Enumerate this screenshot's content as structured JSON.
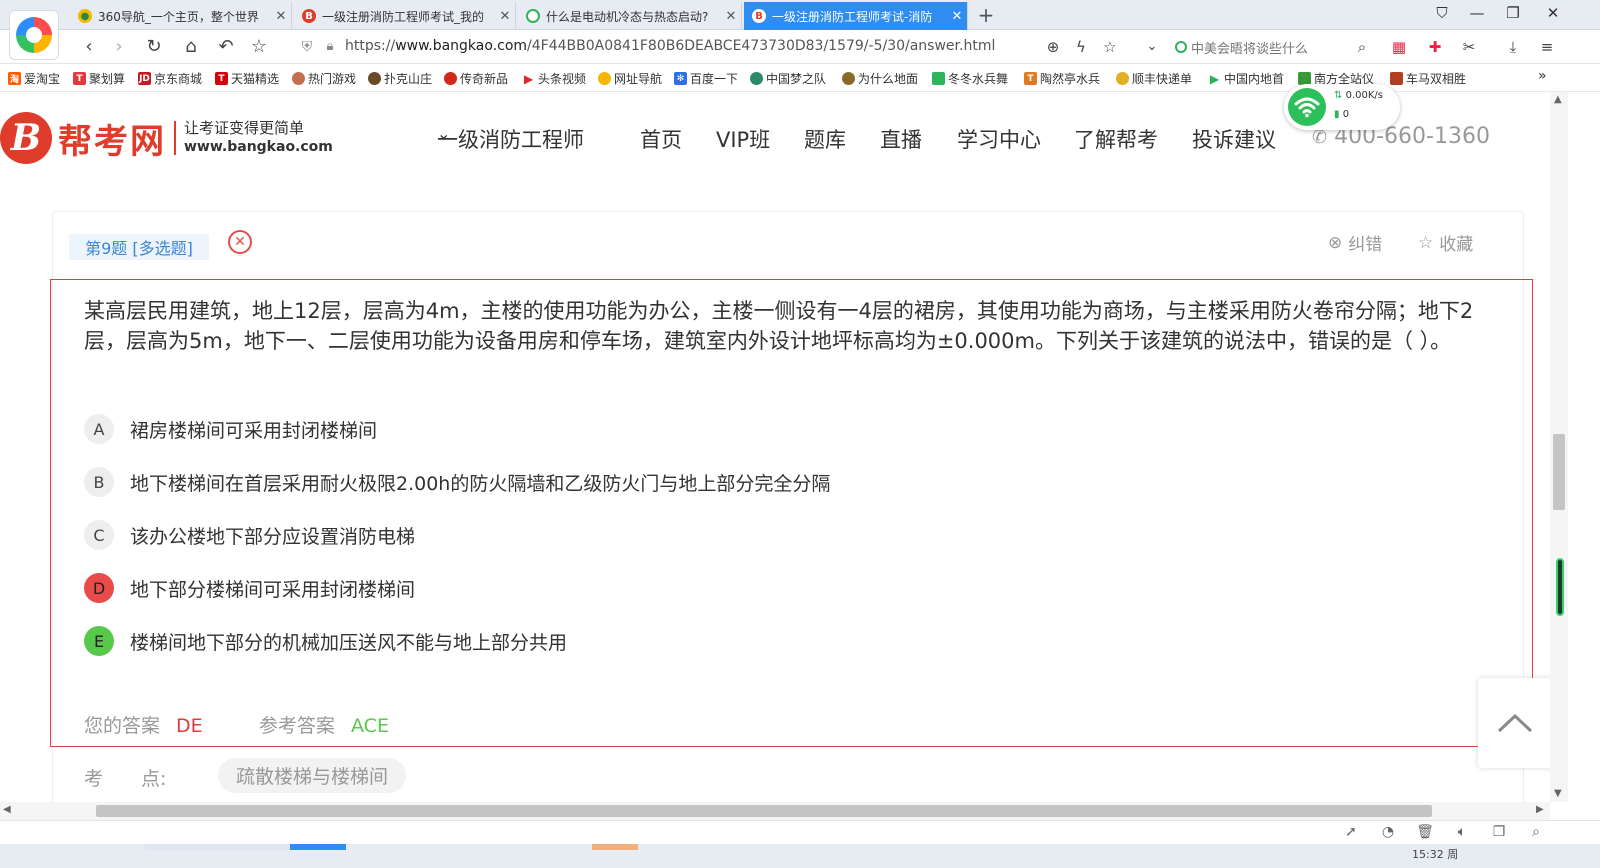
{
  "browser": {
    "tabs": [
      {
        "title": "360导航_一个主页，整个世界",
        "icon": "360-nav-icon",
        "color": "#f5b800"
      },
      {
        "title": "一级注册消防工程师考试_我的",
        "icon": "bangkao-icon",
        "color": "#e03c2c"
      },
      {
        "title": "什么是电动机冷态与热态启动?",
        "icon": "search-icon",
        "color": "#2db45a"
      },
      {
        "title": "一级注册消防工程师考试-消防",
        "icon": "bangkao-icon",
        "color": "#e03c2c"
      }
    ],
    "new_tab": "+",
    "url_prefix": "https://",
    "url_host": "www.bangkao.com",
    "url_path": "/4F44BB0A0841F80B6DEABCE473730D83/1579/-5/30/answer.html",
    "search_placeholder": "中美会晤将谈些什么",
    "bookmarks": [
      {
        "label": "爱淘宝",
        "color": "#ff5a00"
      },
      {
        "label": "聚划算",
        "color": "#e4393c"
      },
      {
        "label": "京东商城",
        "color": "#c81623"
      },
      {
        "label": "天猫精选",
        "color": "#d4000a"
      },
      {
        "label": "热门游戏",
        "color": "#c07050"
      },
      {
        "label": "扑克山庄",
        "color": "#6b4a2a"
      },
      {
        "label": "传奇新品",
        "color": "#d0281b"
      },
      {
        "label": "头条视频",
        "color": "#e0282b"
      },
      {
        "label": "网址导航",
        "color": "#f5b800"
      },
      {
        "label": "百度一下",
        "color": "#2f6fe0"
      },
      {
        "label": "中国梦之队",
        "color": "#2a8a6a"
      },
      {
        "label": "为什么地面",
        "color": "#8a6a2a"
      },
      {
        "label": "冬冬水兵舞",
        "color": "#2db45a"
      },
      {
        "label": "陶然亭水兵",
        "color": "#e07a20"
      },
      {
        "label": "顺丰快递单",
        "color": "#e0b020"
      },
      {
        "label": "中国内地首",
        "color": "#2db45a"
      },
      {
        "label": "南方全站仪",
        "color": "#3a9a3a"
      },
      {
        "label": "车马双相胜",
        "color": "#b04020"
      }
    ],
    "more": "»",
    "net_speed": "0.00K/s",
    "net_count": "0",
    "clock": "15:32 周"
  },
  "site": {
    "logo_char": "B",
    "logo_name": "帮考网",
    "slogan": "让考证变得更简单",
    "slogan_url": "www.bangkao.com",
    "nav": [
      "一级消防工程师",
      "首页",
      "VIP班",
      "题库",
      "直播",
      "学习中心",
      "了解帮考",
      "投诉建议"
    ],
    "phone": "400-660-1360"
  },
  "question": {
    "tag": "第9题 [多选题]",
    "report": "纠错",
    "favorite": "收藏",
    "stem": "某高层民用建筑，地上12层，层高为4m，主楼的使用功能为办公，主楼一侧设有一4层的裙房，其使用功能为商场，与主楼采用防火卷帘分隔；地下2层，层高为5m，地下一、二层使用功能为设备用房和停车场，建筑室内外设计地坪标高均为±0.000m。下列关于该建筑的说法中，错误的是（ ）。",
    "options": [
      {
        "letter": "A",
        "text": "裙房楼梯间可采用封闭楼梯间",
        "state": "none"
      },
      {
        "letter": "B",
        "text": "地下楼梯间在首层采用耐火极限2.00h的防火隔墙和乙级防火门与地上部分完全分隔",
        "state": "none"
      },
      {
        "letter": "C",
        "text": "该办公楼地下部分应设置消防电梯",
        "state": "none"
      },
      {
        "letter": "D",
        "text": "地下部分楼梯间可采用封闭楼梯间",
        "state": "wrong"
      },
      {
        "letter": "E",
        "text": "楼梯间地下部分的机械加压送风不能与地上部分共用",
        "state": "right"
      }
    ],
    "your_answer_label": "您的答案",
    "your_answer": "DE",
    "ref_answer_label": "参考答案",
    "ref_answer": "ACE",
    "kd_label": "考　　点:",
    "kd_value": "疏散楼梯与楼梯间"
  },
  "colors": {
    "accent": "#2f8cf0",
    "brand": "#e03c2c",
    "wrong": "#e94a4a",
    "right": "#57c84a"
  }
}
